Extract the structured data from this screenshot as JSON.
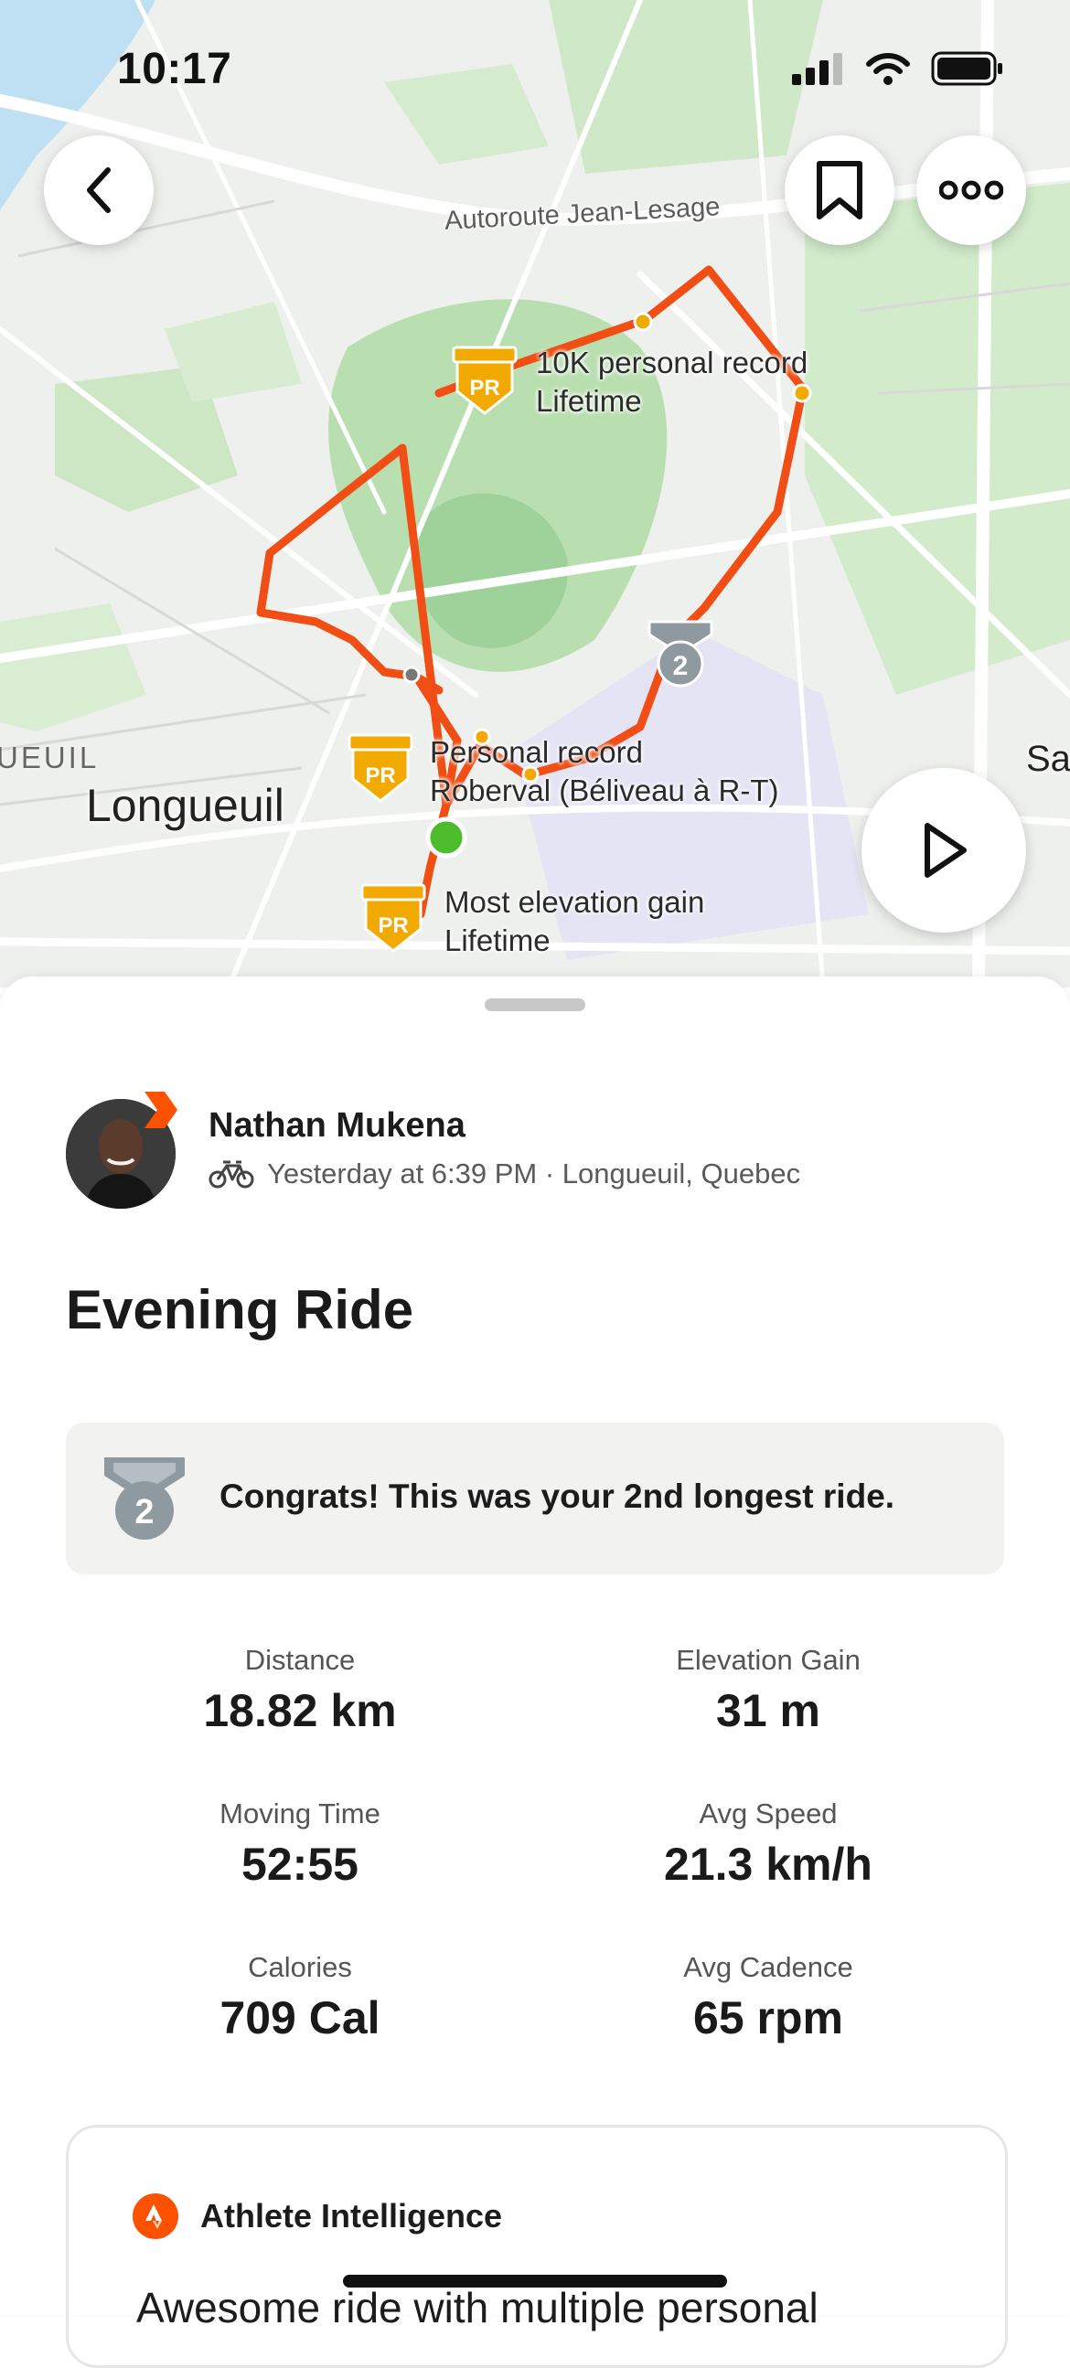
{
  "status_bar": {
    "time": "10:17"
  },
  "map": {
    "road_label": "Autoroute Jean-Lesage",
    "city_label": "Longueuil",
    "edge_label_left": "UEUIL",
    "edge_label_right": "Sa",
    "markers": [
      {
        "badge": "PR",
        "line1": "10K personal record",
        "line2": "Lifetime"
      },
      {
        "badge": "PR",
        "line1": "Personal record",
        "line2": "Roberval (Béliveau à R-T)"
      },
      {
        "badge": "PR",
        "line1": "Most elevation gain",
        "line2": "Lifetime"
      }
    ],
    "route_color": "#f04e14",
    "pr_badge_color": "#f2a900",
    "second_place_badge": "2"
  },
  "athlete": {
    "name": "Nathan Mukena",
    "meta": "Yesterday at 6:39 PM · Longueuil, Quebec",
    "activity_icon": "bicycle-icon"
  },
  "activity": {
    "title": "Evening Ride",
    "achievement": {
      "rank": "2",
      "text": "Congrats! This was your 2nd longest ride."
    }
  },
  "stats": [
    {
      "label": "Distance",
      "value": "18.82 km"
    },
    {
      "label": "Elevation Gain",
      "value": "31 m"
    },
    {
      "label": "Moving Time",
      "value": "52:55"
    },
    {
      "label": "Avg Speed",
      "value": "21.3 km/h"
    },
    {
      "label": "Calories",
      "value": "709 Cal"
    },
    {
      "label": "Avg Cadence",
      "value": "65 rpm"
    }
  ],
  "athlete_intelligence": {
    "title": "Athlete Intelligence",
    "body": "Awesome ride with multiple personal"
  },
  "colors": {
    "brand": "#fc5200",
    "card_bg": "#f2f2f1"
  }
}
